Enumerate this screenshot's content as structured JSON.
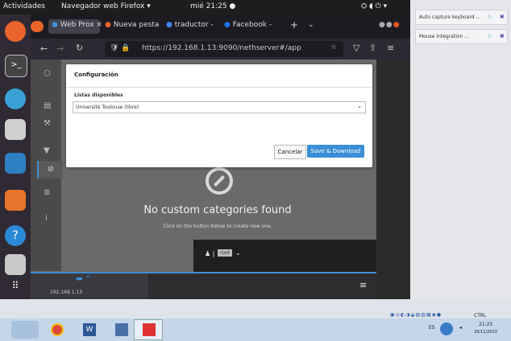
{
  "gnome": {
    "activities": "Actividades",
    "app_menu": "Navegador web Firefox ▾",
    "clock": "mié 21:25 ●"
  },
  "firefox": {
    "tabs": [
      {
        "label": "Web Prox"
      },
      {
        "label": "Nueva pesta"
      },
      {
        "label": "traductor - "
      },
      {
        "label": "Facebook - "
      }
    ],
    "url": "https://192.168.1.13:9090/nethserver#/app"
  },
  "modal": {
    "title": "Configuración",
    "field_label": "Listas disponibles",
    "select_value": "Université Toulouse (libre)",
    "cancel_label": "Cancelar",
    "save_label": "Save & Download"
  },
  "empty_state": {
    "title": "No custom categories found",
    "subtitle": "Click on the button below to create new one."
  },
  "user_menu": {
    "label": "root"
  },
  "footer": {
    "host_ip": "192.168.1.13"
  },
  "host_panel": {
    "notes": [
      {
        "label": "Auto capture keyboard ..."
      },
      {
        "label": "Mouse integration ..."
      }
    ]
  },
  "taskbar": {
    "tray_text": "CTRL DERECHA",
    "lang": "ES",
    "time": "21:25",
    "date": "29/11/2023"
  },
  "colors": {
    "accent": "#3a8fd6",
    "dock": "#2f2a33",
    "taskbar": "#c5d6ea"
  }
}
